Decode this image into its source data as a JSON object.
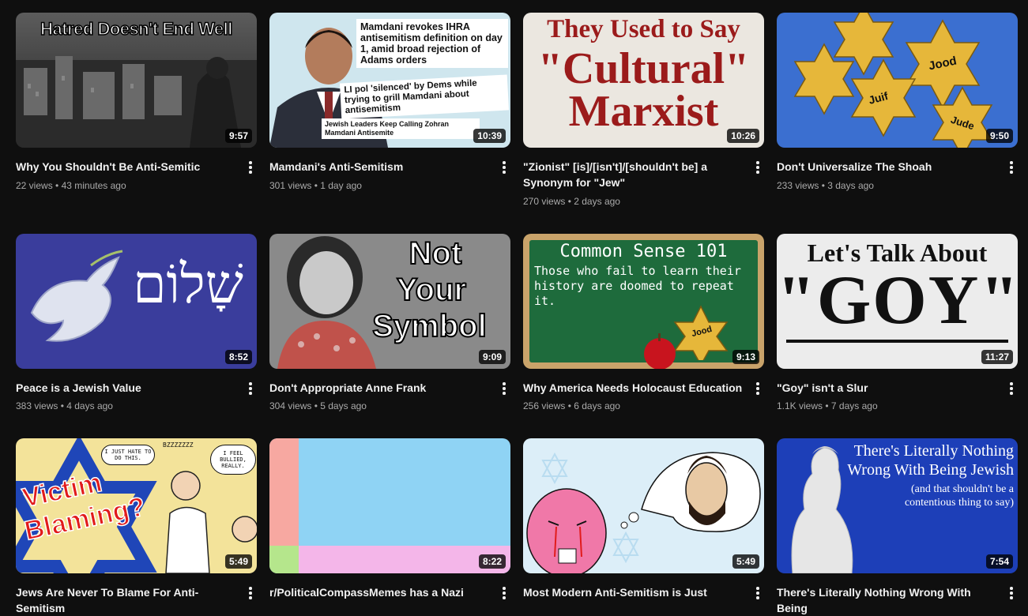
{
  "videos": [
    {
      "title": "Why You Shouldn't Be Anti-Semitic",
      "views": "22 views",
      "age": "43 minutes ago",
      "duration": "9:57",
      "overlay": "Hatred Doesn't End Well"
    },
    {
      "title": "Mamdani's Anti-Semitism",
      "views": "301 views",
      "age": "1 day ago",
      "duration": "10:39",
      "overlay_a": "Mamdani revokes IHRA antisemitism definition on day 1, amid broad rejection of Adams orders",
      "overlay_b": "LI pol 'silenced' by Dems while trying to grill Mamdani about antisemitism",
      "overlay_c": "Jewish Leaders Keep Calling Zohran Mamdani Antisemite"
    },
    {
      "title": "\"Zionist\" [is]/[isn't]/[shouldn't be] a Synonym for \"Jew\"",
      "views": "270 views",
      "age": "2 days ago",
      "duration": "10:26",
      "overlay_a": "They Used to Say",
      "overlay_b": "\"Cultural\"",
      "overlay_c": "Marxist"
    },
    {
      "title": "Don't Universalize The Shoah",
      "views": "233 views",
      "age": "3 days ago",
      "duration": "9:50",
      "overlay_a": "Jood",
      "overlay_b": "Juif",
      "overlay_c": "Jude"
    },
    {
      "title": "Peace is a Jewish Value",
      "views": "383 views",
      "age": "4 days ago",
      "duration": "8:52",
      "overlay": "שָׁלוֹם"
    },
    {
      "title": "Don't Appropriate Anne Frank",
      "views": "304 views",
      "age": "5 days ago",
      "duration": "9:09",
      "overlay_a": "Not",
      "overlay_b": "Your",
      "overlay_c": "Symbol"
    },
    {
      "title": "Why America Needs Holocaust Education",
      "views": "256 views",
      "age": "6 days ago",
      "duration": "9:13",
      "overlay_a": "Common Sense 101",
      "overlay_b": "Those who fail to learn their history are doomed to repeat it.",
      "overlay_c": "Jood"
    },
    {
      "title": "\"Goy\" isn't a Slur",
      "views": "1.1K views",
      "age": "7 days ago",
      "duration": "11:27",
      "overlay_a": "Let's Talk About",
      "overlay_b": "\"GOY\""
    },
    {
      "title": "Jews Are Never To Blame For Anti-Semitism",
      "views": "",
      "age": "",
      "duration": "5:49",
      "overlay_a": "Victim",
      "overlay_b": "Blaming?",
      "overlay_c": "I JUST HATE TO DO THIS.",
      "overlay_d": "I FEEL BULLIED, REALLY.",
      "overlay_e": "BZZZZZZZ"
    },
    {
      "title": "r/PoliticalCompassMemes has a Nazi",
      "views": "",
      "age": "",
      "duration": "8:22"
    },
    {
      "title": "Most Modern Anti-Semitism is Just",
      "views": "",
      "age": "",
      "duration": "5:49"
    },
    {
      "title": "There's Literally Nothing Wrong With Being",
      "views": "",
      "age": "",
      "duration": "7:54",
      "overlay_a": "There's Literally Nothing Wrong With Being Jewish",
      "overlay_b": "(and that shouldn't be a contentious thing to say)"
    }
  ]
}
